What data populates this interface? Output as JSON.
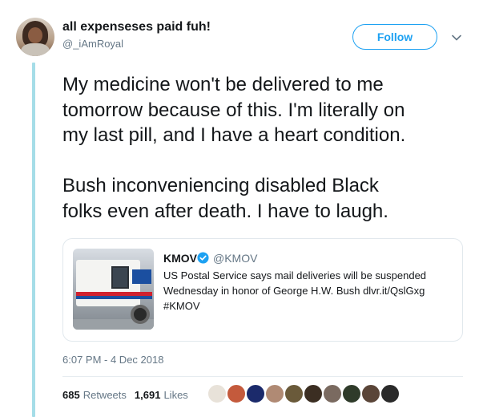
{
  "author": {
    "display_name": "all expenseses paid fuh!",
    "handle": "@_iAmRoyal"
  },
  "follow_label": "Follow",
  "tweet": {
    "paragraphs": [
      [
        "My medicine won't be delivered to me",
        "tomorrow because of this. I'm literally on",
        "my last pill, and I have a heart condition."
      ],
      [
        "Bush inconveniencing disabled Black",
        "folks even after death. I have to laugh."
      ]
    ]
  },
  "quote": {
    "name": "KMOV",
    "handle": "@KMOV",
    "text_lines": [
      "US Postal Service says mail deliveries will be suspended",
      "Wednesday in honor of George H.W. Bush dlvr.it/QslGxg",
      "#KMOV"
    ],
    "image_icon": "mail-truck-image"
  },
  "timestamp": "6:07 PM - 4 Dec 2018",
  "stats": {
    "retweets_count": "685",
    "retweets_label": "Retweets",
    "likes_count": "1,691",
    "likes_label": "Likes"
  },
  "likers_colors": [
    "#e8e2d9",
    "#c45a3c",
    "#1b2a6b",
    "#b08a74",
    "#6a5a3a",
    "#3b2e22",
    "#7a6a60",
    "#2f3b2a",
    "#5a4538",
    "#2a2a2a"
  ],
  "colors": {
    "accent": "#1da1f2",
    "thread_line": "#a5dde8",
    "muted": "#657786"
  }
}
